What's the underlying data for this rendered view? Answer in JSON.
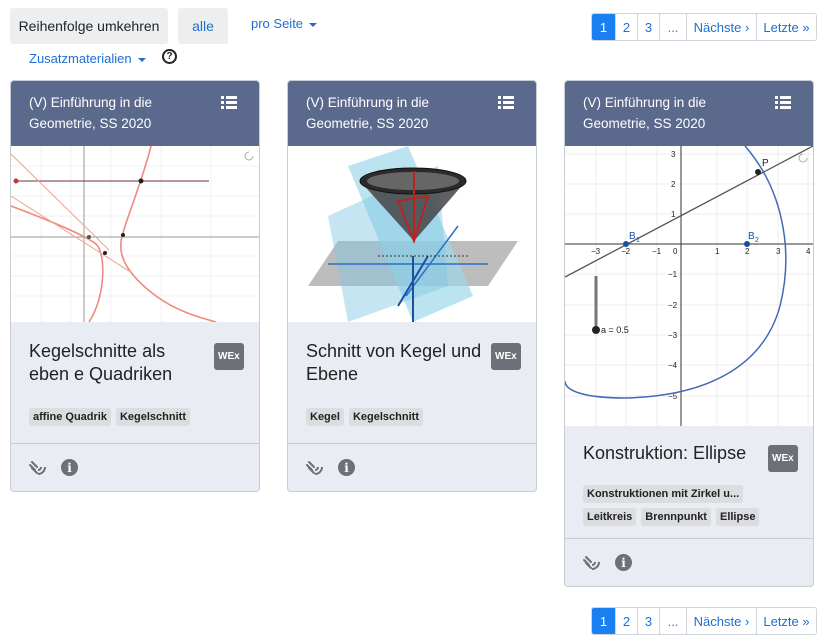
{
  "toolbar": {
    "reverse_label": "Reihenfolge umkehren",
    "all_label": "alle",
    "per_page_label": "pro Seite",
    "materials_label": "Zusatzmaterialien",
    "help_glyph": "?"
  },
  "pagination": {
    "pages": [
      "1",
      "2",
      "3"
    ],
    "ellipsis": "...",
    "next": "Nächste ›",
    "last": "Letzte »"
  },
  "cards": [
    {
      "course": "(V) Einführung in die Geometrie, SS 2020",
      "title": "Kegelschnitte als eben e Quadriken",
      "badge": "WEx",
      "tags": [
        "affine Quadrik",
        "Kegelschnitt"
      ]
    },
    {
      "course": "(V) Einführung in die Geometrie, SS 2020",
      "title": "Schnitt von Kegel und Ebene",
      "badge": "WEx",
      "tags": [
        "Kegel",
        "Kegelschnitt"
      ]
    },
    {
      "course": "(V) Einführung in die Geometrie, SS 2020",
      "title": "Konstruktion: Ellipse",
      "badge": "WEx",
      "tags": [
        "Konstruktionen mit Zirkel u...",
        "Leitkreis",
        "Brennpunkt",
        "Ellipse"
      ],
      "plot": {
        "point_P": "P",
        "point_B1": "B",
        "point_B1_sub": "1",
        "point_B2": "B",
        "point_B2_sub": "2",
        "slider_label": "a = 0.5",
        "x_ticks": [
          "−3",
          "−2",
          "−1",
          "0",
          "1",
          "2",
          "3",
          "4"
        ],
        "y_ticks": [
          "3",
          "2",
          "1",
          "−1",
          "−2",
          "−3",
          "−4",
          "−5"
        ]
      }
    }
  ],
  "icons": {
    "list": "list-icon",
    "wifi": "signal-icon",
    "info": "info-icon",
    "info_glyph": "i"
  }
}
